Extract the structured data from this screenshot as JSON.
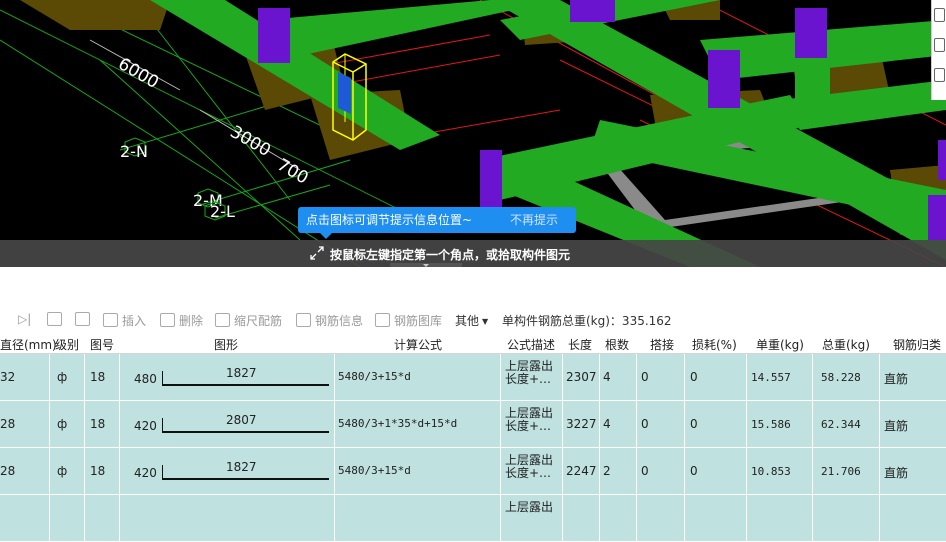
{
  "viewport": {
    "axis_labels": [
      "2-N",
      "2-M",
      "2-L"
    ],
    "dimensions": [
      "6000",
      "3000",
      "700"
    ],
    "tip_bubble": {
      "text": "点击图标可调节提示信息位置~",
      "dismiss": "不再提示"
    },
    "status_text": "按鼠标左键指定第一个角点，或拾取构件图元"
  },
  "toolbar": {
    "insert": "插入",
    "delete": "删除",
    "scale": "缩尺配筋",
    "rebar_info": "钢筋信息",
    "rebar_library": "钢筋图库",
    "other": "其他",
    "total_weight_label": "单构件钢筋总重(kg)：335.162"
  },
  "table": {
    "headers": [
      "直径(mm)",
      "级别",
      "图号",
      "图形",
      "计算公式",
      "公式描述",
      "长度",
      "根数",
      "搭接",
      "损耗(%)",
      "单重(kg)",
      "总重(kg)",
      "钢筋归类"
    ],
    "rows": [
      {
        "diameter": "32",
        "grade": "ф",
        "fig_no": "18",
        "hook": "480",
        "shape_len": "1827",
        "formula": "5480/3+15*d",
        "desc": "上层露出长度+…",
        "length": "2307",
        "count": "4",
        "lap": "0",
        "loss": "0",
        "unit_weight": "14.557",
        "total_weight": "58.228",
        "category": "直筋"
      },
      {
        "diameter": "28",
        "grade": "ф",
        "fig_no": "18",
        "hook": "420",
        "shape_len": "2807",
        "formula": "5480/3+1*35*d+15*d",
        "desc": "上层露出长度+…",
        "length": "3227",
        "count": "4",
        "lap": "0",
        "loss": "0",
        "unit_weight": "15.586",
        "total_weight": "62.344",
        "category": "直筋"
      },
      {
        "diameter": "28",
        "grade": "ф",
        "fig_no": "18",
        "hook": "420",
        "shape_len": "1827",
        "formula": "5480/3+15*d",
        "desc": "上层露出长度+…",
        "length": "2247",
        "count": "2",
        "lap": "0",
        "loss": "0",
        "unit_weight": "10.853",
        "total_weight": "21.706",
        "category": "直筋"
      },
      {
        "desc": "上层露出"
      }
    ]
  },
  "colors": {
    "beam": "#22aa22",
    "column": "#6a14d0",
    "footing": "#5a4a05",
    "selected": "#ffff00",
    "tip": "#1e8ef0",
    "row_bg": "#bfe1e0"
  }
}
